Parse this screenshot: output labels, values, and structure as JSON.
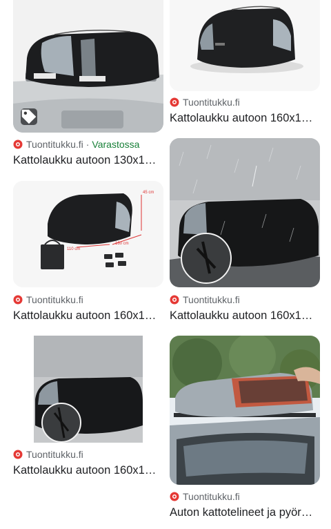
{
  "results": [
    {
      "source": "Tuontitukku.fi",
      "availability": "Varastossa",
      "title": "Kattolaukku autoon 130x1…",
      "has_tag_icon": true
    },
    {
      "source": "Tuontitukku.fi",
      "title": "Kattolaukku autoon 160x1…"
    },
    {
      "source": "Tuontitukku.fi",
      "title": "Kattolaukku autoon 160x1…",
      "dims": {
        "h": "45 cm",
        "w": "110 cm",
        "l": "160 cm"
      }
    },
    {
      "source": "Tuontitukku.fi",
      "title": "Kattolaukku autoon 160x1…"
    },
    {
      "source": "Tuontitukku.fi",
      "title": "Kattolaukku autoon 160x1…"
    },
    {
      "source": "Tuontitukku.fi",
      "title": "Auton kattotelineet ja pyör…"
    }
  ],
  "colors": {
    "source_text": "#5f6368",
    "availability": "#188038",
    "favicon": "#e53935"
  }
}
